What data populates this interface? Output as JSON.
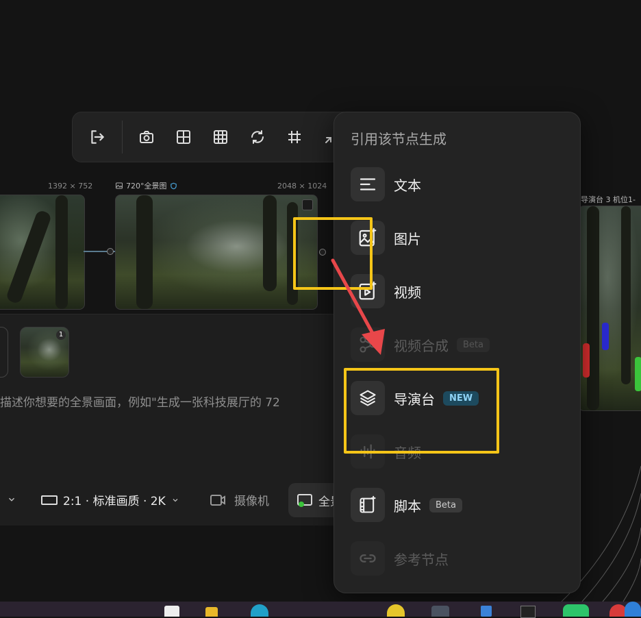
{
  "canvas": {
    "node_left_size": "1392 × 752",
    "node_main_title": "720°全景图",
    "node_main_size": "2048 × 1024",
    "node_right_title": "导演台 3 机位1-"
  },
  "panel": {
    "thumb_badge": "1",
    "prompt_placeholder": "描述你想要的全景画面，例如\"生成一张科技展厅的 72",
    "ratio_quality": "2:1 · 标准画质 · 2K",
    "camera_label": "摄像机",
    "panorama_label": "全景"
  },
  "toolbar": {
    "icons": [
      "exit-icon",
      "camera-icon",
      "grid-2x2-icon",
      "grid-3x3-icon",
      "refresh-icon",
      "hash-grid-icon",
      "shrink-icon"
    ]
  },
  "menu": {
    "title": "引用该节点生成",
    "items": [
      {
        "label": "文本",
        "icon": "text-lines-icon",
        "badge": "",
        "enabled": true
      },
      {
        "label": "图片",
        "icon": "image-spark-icon",
        "badge": "",
        "enabled": true
      },
      {
        "label": "视频",
        "icon": "video-spark-icon",
        "badge": "",
        "enabled": true
      },
      {
        "label": "视频合成",
        "icon": "merge-icon",
        "badge": "Beta",
        "enabled": false
      },
      {
        "label": "导演台",
        "icon": "layers-icon",
        "badge": "NEW",
        "enabled": true
      },
      {
        "label": "音频",
        "icon": "audio-wave-icon",
        "badge": "",
        "enabled": false
      },
      {
        "label": "脚本",
        "icon": "film-script-icon",
        "badge": "Beta",
        "enabled": true
      },
      {
        "label": "参考节点",
        "icon": "link-icon",
        "badge": "",
        "enabled": false
      }
    ]
  },
  "colors": {
    "highlight": "#f5c518",
    "arrow": "#e8474a",
    "new_badge_bg": "#1d4a5e",
    "new_badge_text": "#8fd3f5"
  }
}
